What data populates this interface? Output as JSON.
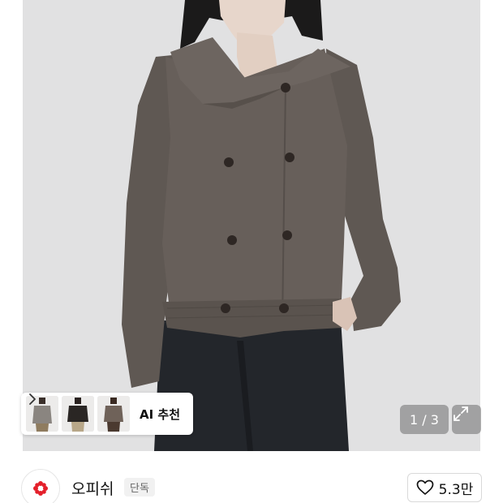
{
  "product_image": {
    "alt": "product photo",
    "counter_current": "1",
    "counter_sep": " / ",
    "counter_total": "3",
    "counter_text": "1 / 3"
  },
  "ai_recommend": {
    "label": "AI 추천",
    "thumbnails": [
      "thumb-grey-knit",
      "thumb-black-knit",
      "thumb-brown-knit"
    ]
  },
  "brand": {
    "name": "오피쉬",
    "badge": "단독",
    "logo_icon": "flower-logo-icon",
    "logo_color": "#e4202b"
  },
  "like": {
    "icon": "heart-icon",
    "count": "5.3만"
  },
  "colors": {
    "background": "#ffffff",
    "hero_bg": "#dfdfe0",
    "cardigan": "#675f5a",
    "accent": "#e4202b"
  }
}
